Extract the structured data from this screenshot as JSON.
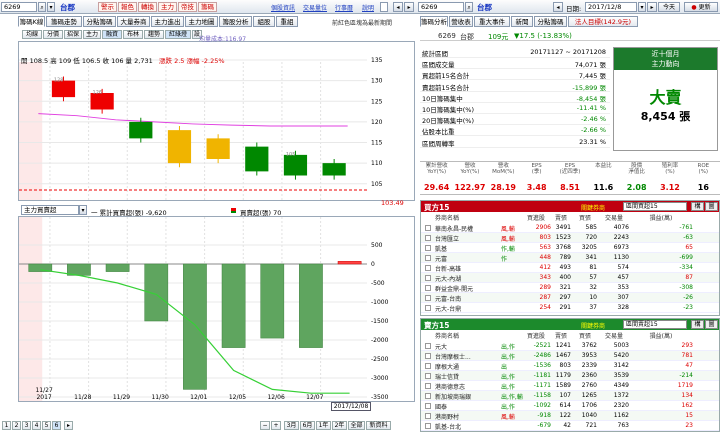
{
  "colors": {
    "up": "#e00",
    "down": "#080",
    "accent": "#c00",
    "lightpink": "#fde8e8",
    "lightgreen": "#eef7ee"
  },
  "top": {
    "code": "6269",
    "name": "台郡",
    "tools": [
      "警示",
      "報色",
      "轉換",
      "主力",
      "帝技",
      "籌碼"
    ],
    "links": [
      "個股資訊",
      "交易量位",
      "行事曆",
      "說明"
    ],
    "date_label": "日期:",
    "date": "2017/12/8",
    "today": "今天",
    "update": "更新"
  },
  "left": {
    "tabs": [
      "籌碼K線",
      "籌碼走勢",
      "分點籌碼",
      "大量券商",
      "主力進出",
      "主力地圖",
      "籌股分析",
      "組股",
      "重組"
    ],
    "tab_note": "前紅色區塊為最新期間",
    "toolbar": [
      "均線",
      "分價",
      "招保",
      "主力",
      "融資",
      "布林",
      "趨勢",
      "紅綠燈",
      "設"
    ],
    "avg_cost": "均量成本:116.97",
    "quote": "開 108.5  高 109  低 106.5  收 106  量 2,731",
    "change": "漲跌 2.5  漲幅 -2.25%",
    "upper_yticks": [
      "135",
      "130",
      "125",
      "120",
      "115",
      "110",
      "105"
    ],
    "last_price": "103.49",
    "lower_select": "主力買賣超",
    "legend1": "一 累計買賣超(張) -9,620",
    "legend2": "買賣超(張) 70",
    "lower_yticks": [
      "500",
      "0",
      "-500",
      "-1000",
      "-1500",
      "-2000",
      "-2500",
      "-3000",
      "-3500"
    ],
    "xticks": [
      "11/27\n2017",
      "11/28",
      "11/29",
      "11/30",
      "12/01",
      "12/05",
      "12/06",
      "12/07"
    ],
    "cursor_date": "2017/12/08",
    "pages": [
      "1",
      "2",
      "3",
      "4",
      "5",
      "6"
    ],
    "zoom_btns": [
      "3月",
      "6月",
      "1年",
      "2年",
      "全部",
      "新資料"
    ],
    "candles": [
      {
        "o": 130,
        "c": 126,
        "h": 131,
        "l": 125,
        "lbl": "128"
      },
      {
        "o": 127,
        "c": 123,
        "h": 128,
        "l": 122,
        "lbl": "126"
      },
      {
        "o": 120,
        "c": 116,
        "h": 121,
        "l": 115,
        "lbl": ""
      },
      {
        "o": 118,
        "c": 110,
        "h": 119,
        "l": 109,
        "lbl": ""
      },
      {
        "o": 116,
        "c": 111,
        "h": 117,
        "l": 110,
        "lbl": ""
      },
      {
        "o": 114,
        "c": 108,
        "h": 115,
        "l": 107,
        "lbl": ""
      },
      {
        "o": 112,
        "c": 107,
        "h": 113,
        "l": 106,
        "lbl": "105"
      },
      {
        "o": 110,
        "c": 107,
        "h": 111,
        "l": 106,
        "lbl": ""
      }
    ],
    "bars": [
      -200,
      -300,
      -200,
      -1500,
      -3300,
      -2200,
      -1950,
      -2200,
      70
    ]
  },
  "right": {
    "tabs": [
      "籌碼分析",
      "營收表",
      "重大事件",
      "新聞",
      "分點籌碼",
      "法人目標(142.9元)"
    ],
    "code": "6269",
    "name": "台郡",
    "price": "109元",
    "change": "▼17.5 (-13.83%)",
    "stats": [
      {
        "k": "統計區間",
        "v": "20171127 ~ 20171208"
      },
      {
        "k": "區間成交量",
        "v": "74,071 張"
      },
      {
        "k": "買超前15名合計",
        "v": "7,445 張"
      },
      {
        "k": "賣超前15名合計",
        "v": "-15,899 張"
      },
      {
        "k": "10日籌碼集中",
        "v": "-8,454 張"
      },
      {
        "k": "10日籌碼集中(%)",
        "v": "-11.41 %"
      },
      {
        "k": "20日籌碼集中(%)",
        "v": "-2.46 %"
      },
      {
        "k": "佔股本比重",
        "v": "-2.66 %"
      },
      {
        "k": "區間周轉率",
        "v": "23.31 %"
      }
    ],
    "signal": {
      "title": "近十個月",
      "sub": "主力動向",
      "big": "大賣",
      "val": "8,454 張"
    },
    "fund_hdr": [
      "累計營收\nYoY(%)",
      "營收\nYoY(%)",
      "營收\nMoM(%)",
      "EPS\n(季)",
      "EPS\n(近四季)",
      "本益比",
      "股價\n淨值比",
      "殖利率\n(%)",
      "ROE\n(%)"
    ],
    "fund_val": [
      "29.64",
      "122.97",
      "28.19",
      "3.48",
      "8.51",
      "11.6",
      "2.08",
      "3.12",
      "16"
    ],
    "buy": {
      "title": "買方15",
      "select": "關鍵券商",
      "select2": "區間買超15",
      "btn1": "構",
      "btn2": "圖",
      "cols": [
        "券商名稱",
        "",
        "買進股",
        "賣張",
        "買張",
        "交易量",
        "損益(萬)"
      ],
      "rows": [
        [
          "華南永昌-民權",
          "風,輸",
          "2906",
          "3491",
          "585",
          "4076",
          "-761"
        ],
        [
          "台灣匯立",
          "風,輸",
          "803",
          "1523",
          "720",
          "2243",
          "-63"
        ],
        [
          "凱基",
          "作,輸",
          "563",
          "3768",
          "3205",
          "6973",
          "65"
        ],
        [
          "元富",
          "作",
          "448",
          "789",
          "341",
          "1130",
          "-699"
        ],
        [
          "台新-高雄",
          "",
          "412",
          "493",
          "81",
          "574",
          "-334"
        ],
        [
          "元大-內湖",
          "",
          "343",
          "400",
          "57",
          "457",
          "87"
        ],
        [
          "群益金鼎-開元",
          "",
          "289",
          "321",
          "32",
          "353",
          "-308"
        ],
        [
          "元富-台南",
          "",
          "287",
          "297",
          "10",
          "307",
          "-26"
        ],
        [
          "元大-台鼎",
          "",
          "254",
          "291",
          "37",
          "328",
          "-23"
        ]
      ]
    },
    "sell": {
      "title": "賣方15",
      "select": "關鍵券商",
      "select2": "區間賣超15",
      "btn1": "構",
      "btn2": "圖",
      "cols": [
        "券商名稱",
        "",
        "買進股",
        "賣張",
        "買張",
        "交易量",
        "損益(萬)"
      ],
      "rows": [
        [
          "元大",
          "出,作",
          "-2521",
          "1241",
          "3762",
          "5003",
          "293"
        ],
        [
          "台灣摩根士...",
          "出,作",
          "-2486",
          "1467",
          "3953",
          "5420",
          "781"
        ],
        [
          "摩根大通",
          "出",
          "-1536",
          "803",
          "2339",
          "3142",
          "47"
        ],
        [
          "瑞士信貸",
          "出,作",
          "-1181",
          "1179",
          "2360",
          "3539",
          "-214"
        ],
        [
          "港商德意志",
          "出,作",
          "-1171",
          "1589",
          "2760",
          "4349",
          "1719"
        ],
        [
          "新加坡商瑞銀",
          "出,作,輸",
          "-1158",
          "107",
          "1265",
          "1372",
          "134"
        ],
        [
          "國泰",
          "出,作",
          "-1092",
          "614",
          "1706",
          "2320",
          "162"
        ],
        [
          "港商野村",
          "風,輸",
          "-918",
          "122",
          "1040",
          "1162",
          "15"
        ],
        [
          "凱基-台北",
          "",
          "-679",
          "42",
          "721",
          "763",
          "23"
        ]
      ]
    }
  }
}
